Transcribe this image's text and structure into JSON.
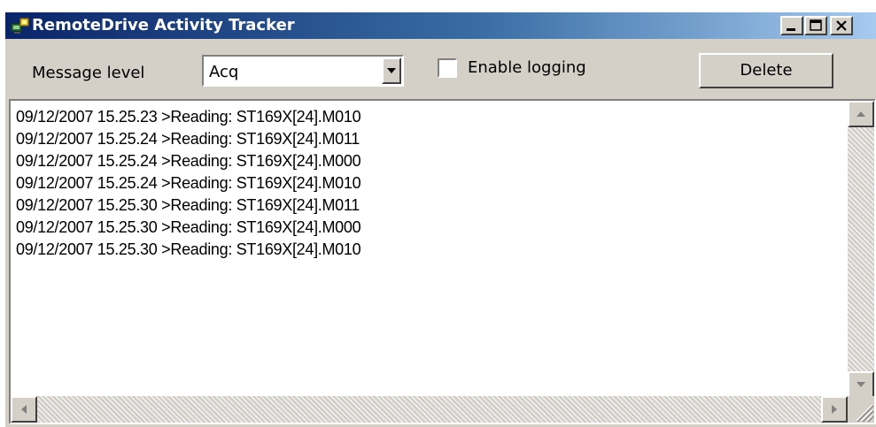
{
  "window": {
    "title": "RemoteDrive Activity Tracker",
    "icon": "app-computer-icon"
  },
  "toolbar": {
    "message_level_label": "Message level",
    "message_level_value": "Acq",
    "logging_label": "Enable logging",
    "logging_checked": false,
    "delete_label": "Delete"
  },
  "log": {
    "lines": [
      "09/12/2007 15.25.23 >Reading: ST169X[24].M010",
      "09/12/2007 15.25.24 >Reading: ST169X[24].M011",
      "09/12/2007 15.25.24 >Reading: ST169X[24].M000",
      "09/12/2007 15.25.24 >Reading: ST169X[24].M010",
      "09/12/2007 15.25.30 >Reading: ST169X[24].M011",
      "09/12/2007 15.25.30 >Reading: ST169X[24].M000",
      "09/12/2007 15.25.30 >Reading: ST169X[24].M010"
    ]
  },
  "colors": {
    "titlebar_start": "#0a246a",
    "titlebar_end": "#a6caf0",
    "face": "#d4d0c8"
  }
}
